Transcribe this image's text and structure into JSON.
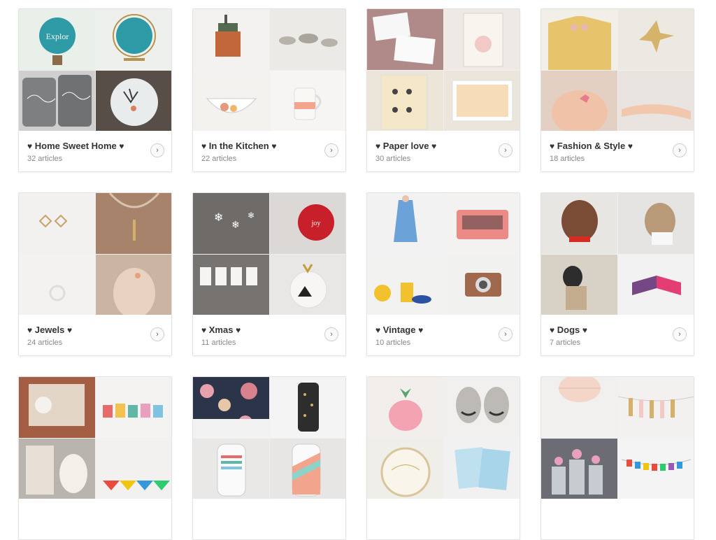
{
  "collections": [
    {
      "title": "Home Sweet Home",
      "count": "32 articles",
      "colors": [
        "#e9efe9",
        "#eef0ee",
        "#7d7f80",
        "#584e48"
      ]
    },
    {
      "title": "In the Kitchen",
      "count": "22 articles",
      "colors": [
        "#f3f2f0",
        "#eceae6",
        "#f4f2ef",
        "#f6f5f3"
      ]
    },
    {
      "title": "Paper love",
      "count": "30 articles",
      "colors": [
        "#b08a88",
        "#eee9e4",
        "#ece6da",
        "#ece5dc"
      ]
    },
    {
      "title": "Fashion & Style",
      "count": "18 articles",
      "colors": [
        "#e7c46b",
        "#ece8e2",
        "#e3d0c2",
        "#e9e4df"
      ]
    },
    {
      "title": "Jewels",
      "count": "24 articles",
      "colors": [
        "#f3f1ef",
        "#a8836b",
        "#f4f2f0",
        "#cbb5a2"
      ]
    },
    {
      "title": "Xmas",
      "count": "11 articles",
      "colors": [
        "#6f6b68",
        "#dcd8d6",
        "#767370",
        "#e9e7e5"
      ]
    },
    {
      "title": "Vintage",
      "count": "10 articles",
      "colors": [
        "#f2f2f2",
        "#f4f2f1",
        "#f2f2f0",
        "#f1f1ef"
      ]
    },
    {
      "title": "Dogs",
      "count": "7 articles",
      "colors": [
        "#e8e6e3",
        "#e6e4e2",
        "#d8d1c5",
        "#f2f2f2"
      ]
    },
    {
      "title": "",
      "count": "",
      "colors": [
        "#a45e44",
        "#f5f3f1",
        "#b9b4ae",
        "#f2f1ef"
      ]
    },
    {
      "title": "",
      "count": "",
      "colors": [
        "#2c3449",
        "#f4f4f4",
        "#e9e8e6",
        "#e7e6e4"
      ]
    },
    {
      "title": "",
      "count": "",
      "colors": [
        "#f1eeec",
        "#f2f0ee",
        "#f0eee9",
        "#f1f1f1"
      ]
    },
    {
      "title": "",
      "count": "",
      "colors": [
        "#f2f0ef",
        "#f3f1ef",
        "#6c6d74",
        "#f4f4f4"
      ]
    }
  ],
  "heart_glyph": "♥",
  "arrow_glyph": "›"
}
